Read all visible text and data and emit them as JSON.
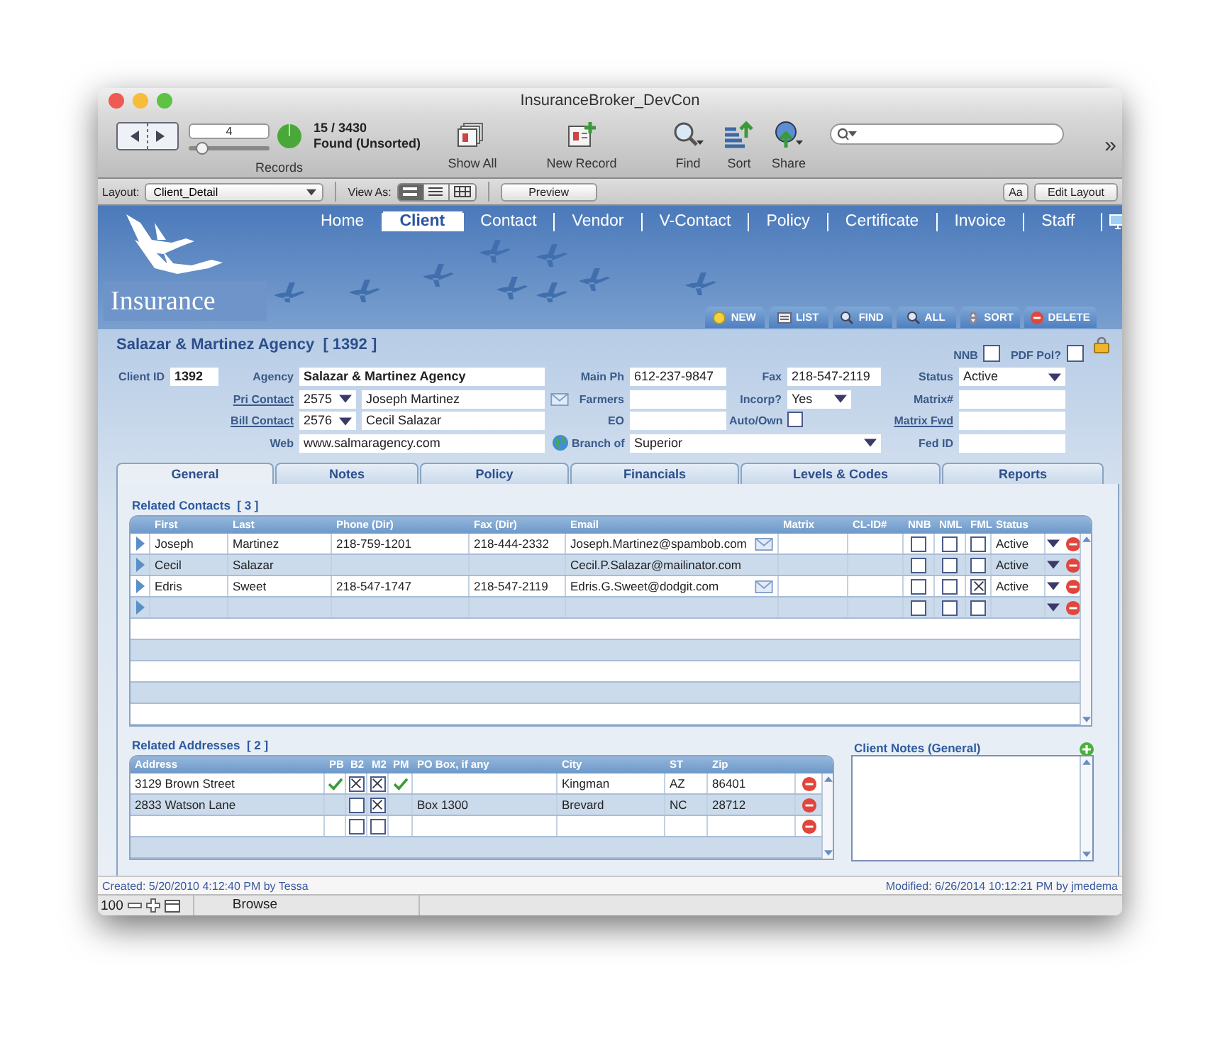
{
  "window": {
    "title": "InsuranceBroker_DevCon"
  },
  "toolbar": {
    "record_number": "4",
    "record_slider": {
      "level": 0.15
    },
    "found_count": "15 / 3430",
    "found_status": "Found (Unsorted)",
    "records_label": "Records",
    "buttons": [
      {
        "kind": "show_all",
        "label": "Show All"
      },
      {
        "kind": "new_record",
        "label": "New Record"
      },
      {
        "kind": "find",
        "label": "Find"
      },
      {
        "kind": "sort",
        "label": "Sort"
      },
      {
        "kind": "share",
        "label": "Share"
      }
    ],
    "more": "»"
  },
  "layout_bar": {
    "layout_label": "Layout:",
    "layout": "Client_Detail",
    "view_as_label": "View As:",
    "view_modes": [
      {
        "kind": "form",
        "selected": true
      },
      {
        "kind": "list",
        "selected": false
      },
      {
        "kind": "table",
        "selected": false
      }
    ],
    "preview": "Preview",
    "format_button": "Aa",
    "edit_layout": "Edit Layout"
  },
  "nav": [
    {
      "label": "Home",
      "selected": false
    },
    {
      "label": "Client",
      "selected": true
    },
    {
      "label": "Contact",
      "selected": false
    },
    {
      "label": "Vendor",
      "selected": false
    },
    {
      "label": "V-Contact",
      "selected": false
    },
    {
      "label": "Policy",
      "selected": false
    },
    {
      "label": "Certificate",
      "selected": false
    },
    {
      "label": "Invoice",
      "selected": false
    },
    {
      "label": "Staff",
      "selected": false
    }
  ],
  "logo": {
    "text": "Insurance"
  },
  "actions": [
    {
      "kind": "new",
      "label": "NEW"
    },
    {
      "kind": "list",
      "label": "LIST"
    },
    {
      "kind": "find",
      "label": "FIND"
    },
    {
      "kind": "all",
      "label": "ALL"
    },
    {
      "kind": "sort",
      "label": "SORT"
    },
    {
      "kind": "delete",
      "label": "DELETE"
    }
  ],
  "record": {
    "title": "Salazar & Martinez Agency  [ 1392 ]",
    "flags": [
      {
        "label": "NNB",
        "checked": false
      },
      {
        "label": "PDF Pol?",
        "checked": false
      }
    ],
    "fields": [
      {
        "label": "Client ID",
        "link": false,
        "kind": "name",
        "value": "1392"
      },
      {
        "label": "Agency",
        "link": false,
        "kind": "name",
        "value": "Salazar & Martinez Agency"
      },
      {
        "label": "Main Ph",
        "link": false,
        "kind": "text",
        "value": "612-237-9847"
      },
      {
        "label": "Fax",
        "link": false,
        "kind": "text",
        "value": "218-547-2119"
      },
      {
        "label": "Status",
        "link": false,
        "kind": "dropdown",
        "value": "Active"
      },
      {
        "label": "Pri Contact",
        "link": true,
        "kind": "mailcontact",
        "id": "2575",
        "value": "Joseph Martinez"
      },
      {
        "label": "Farmers",
        "link": false,
        "kind": "text"
      },
      {
        "label": "Incorp?",
        "link": false,
        "kind": "dropdown",
        "value": "Yes"
      },
      {
        "label": "Matrix#",
        "link": false,
        "kind": "text"
      },
      {
        "label": "Bill Contact",
        "link": true,
        "kind": "contact",
        "id": "2576",
        "value": "Cecil Salazar"
      },
      {
        "label": "EO",
        "link": false,
        "kind": "text"
      },
      {
        "label": "Auto/Own",
        "link": false,
        "kind": "checkbox",
        "checked": false
      },
      {
        "label": "Matrix Fwd",
        "link": true,
        "kind": "text"
      },
      {
        "label": "Web",
        "link": false,
        "kind": "url",
        "value": "www.salmaragency.com"
      },
      {
        "label": "Branch of",
        "link": false,
        "kind": "dropdown",
        "value": "Superior"
      },
      {
        "label": "Fed ID",
        "link": false,
        "kind": "text"
      }
    ]
  },
  "tabs": [
    {
      "label": "General",
      "selected": true
    },
    {
      "label": "Notes",
      "selected": false
    },
    {
      "label": "Policy",
      "selected": false
    },
    {
      "label": "Financials",
      "selected": false
    },
    {
      "label": "Levels & Codes",
      "selected": false
    },
    {
      "label": "Reports",
      "selected": false
    }
  ],
  "contacts": {
    "title": "Related Contacts  [ 3 ]",
    "columns": [
      "First",
      "Last",
      "Phone (Dir)",
      "Fax (Dir)",
      "Email",
      "Matrix",
      "CL-ID#",
      "NNB",
      "NML",
      "FML",
      "Status"
    ],
    "rows": [
      {
        "first": "Joseph",
        "last": "Martinez",
        "phone": "218-759-1201",
        "fax": "218-444-2332",
        "email": "Joseph.Martinez@spambob.com",
        "mail_button": true,
        "nnb": false,
        "nml": false,
        "fml": false,
        "status": "Active"
      },
      {
        "first": "Cecil",
        "last": "Salazar",
        "email": "Cecil.P.Salazar@mailinator.com",
        "mail_button": false,
        "nnb": false,
        "nml": false,
        "fml": false,
        "status": "Active"
      },
      {
        "first": "Edris",
        "last": "Sweet",
        "phone": "218-547-1747",
        "fax": "218-547-2119",
        "email": "Edris.G.Sweet@dodgit.com",
        "mail_button": true,
        "nnb": false,
        "nml": false,
        "fml": true,
        "status": "Active"
      },
      {
        "mail_button": false,
        "nnb": false,
        "nml": false,
        "fml": false
      }
    ]
  },
  "addresses": {
    "title": "Related Addresses  [ 2 ]",
    "columns": [
      "Address",
      "PB",
      "B2",
      "M2",
      "PM",
      "PO Box, if any",
      "City",
      "ST",
      "Zip"
    ],
    "rows": [
      {
        "address": "3129 Brown Street",
        "pb": true,
        "b2": true,
        "m2": true,
        "pm": true,
        "city": "Kingman",
        "st": "AZ",
        "zip": "86401"
      },
      {
        "address": "2833 Watson Lane",
        "pb": false,
        "b2": false,
        "m2": true,
        "pm": false,
        "po_box": "Box 1300",
        "city": "Brevard",
        "st": "NC",
        "zip": "28712"
      },
      {
        "pb": false,
        "b2": false,
        "m2": false,
        "pm": false
      }
    ]
  },
  "notes": {
    "title": "Client Notes (General)"
  },
  "footer": {
    "created": "Created: 5/20/2010 4:12:40 PM by Tessa",
    "modified": "Modified: 6/26/2014 10:12:21 PM by jmedema"
  },
  "status_bar": {
    "zoom": "100",
    "mode": "Browse"
  }
}
